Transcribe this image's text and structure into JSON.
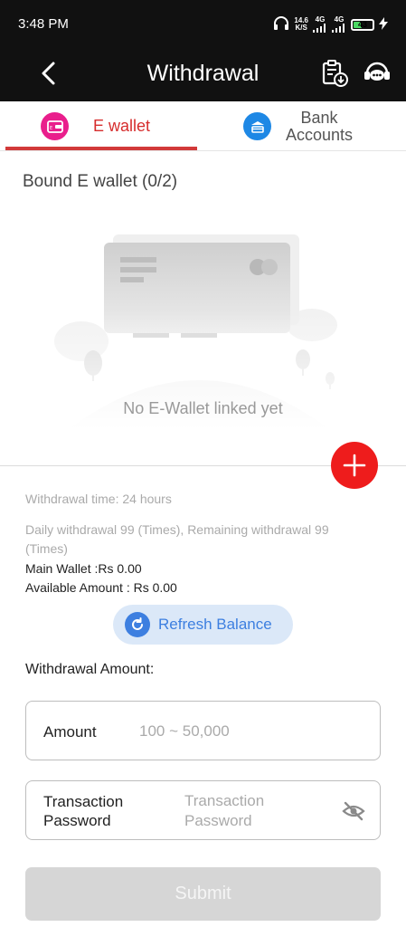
{
  "status_bar": {
    "time": "3:48 PM",
    "speed_value": "14.6",
    "speed_unit": "K/S",
    "net1": "4G",
    "net2": "4G",
    "battery": "43",
    "battery_level": 0.43
  },
  "header": {
    "title": "Withdrawal",
    "back_icon": "chevron-left-icon",
    "record_icon": "clipboard-download-icon",
    "support_icon": "chat-support-icon"
  },
  "tabs": [
    {
      "label": "E wallet",
      "icon": "wallet-icon",
      "icon_color": "#e91e8c",
      "active": true
    },
    {
      "label_line1": "Bank",
      "label_line2": "Accounts",
      "icon": "bank-card-icon",
      "icon_color": "#1e88e5",
      "active": false
    }
  ],
  "bound": {
    "title": "Bound E wallet (0/2)",
    "empty_text": "No E-Wallet linked yet"
  },
  "info": {
    "withdrawal_time": "Withdrawal time:  24 hours",
    "daily_line1": "Daily withdrawal 99 (Times), Remaining withdrawal 99",
    "daily_line2": "(Times)",
    "main_wallet": "Main Wallet :Rs 0.00",
    "available_amount": "Available Amount : Rs 0.00"
  },
  "refresh": {
    "label": "Refresh Balance"
  },
  "form": {
    "section_title": "Withdrawal Amount:",
    "amount_label": "Amount",
    "amount_placeholder": "100 ~ 50,000",
    "password_label_line1": "Transaction",
    "password_label_line2": "Password",
    "password_placeholder": "Transaction\nPassword"
  },
  "submit": {
    "label": "Submit"
  },
  "colors": {
    "accent_red": "#ee1c1c",
    "tab_active": "#d62d2d",
    "refresh_blue": "#3d7fe0",
    "submit_disabled": "#d6d6d6"
  }
}
